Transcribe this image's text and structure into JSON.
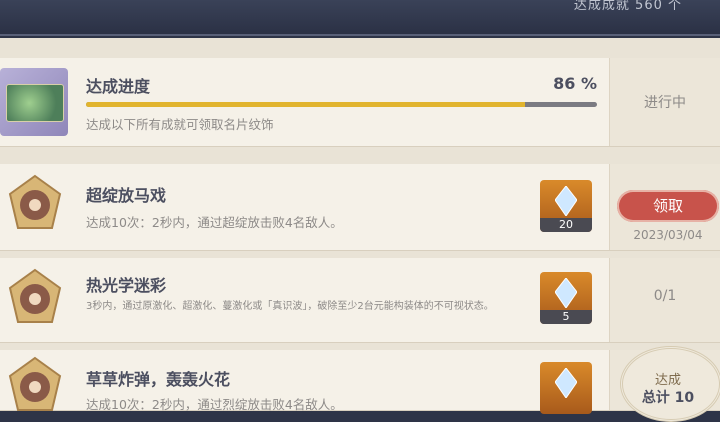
{
  "topbar": {
    "text": "达成成就 560 个"
  },
  "progress": {
    "title": "达成进度",
    "percent_label": "86 %",
    "percent": 86,
    "description": "达成以下所有成就可领取名片纹饰",
    "status": "进行中"
  },
  "achievements": [
    {
      "title": "超绽放马戏",
      "description": "达成10次：2秒内，通过超绽放击败4名敌人。",
      "reward_count": "20",
      "action_label": "领取",
      "date": "2023/03/04"
    },
    {
      "title": "热光学迷彩",
      "description": "3秒内，通过原激化、超激化、蔓激化或「真识波」，破除至少2台元能构装体的不可视状态。",
      "reward_count": "5",
      "status": "0/1"
    },
    {
      "title": "草草炸弹，轰轰火花",
      "description": "达成10次：2秒内，通过烈绽放击败4名敌人。",
      "stamp_label": "达成",
      "stamp_total": "总计 10"
    }
  ],
  "colors": {
    "accent_bar": "#e1b42e",
    "claim_button": "#c8534b",
    "card_bg": "#f5f1e8"
  },
  "icons": [
    "namecard-icon",
    "achievement-badge-icon",
    "primogem-icon"
  ]
}
